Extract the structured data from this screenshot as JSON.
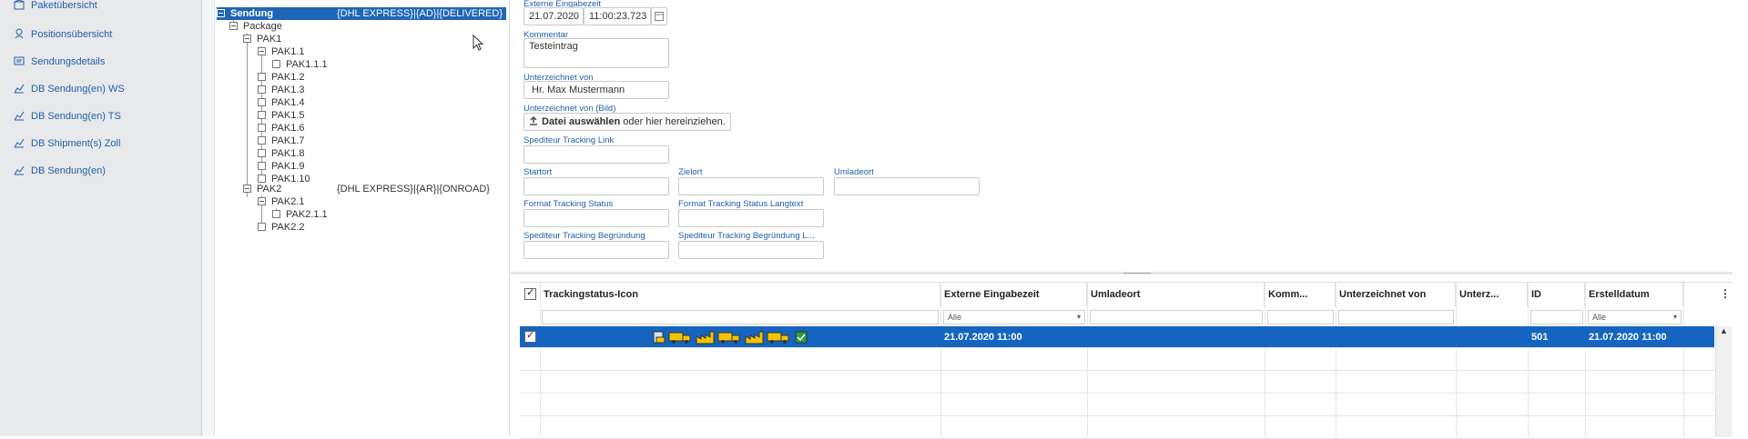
{
  "sidebar": {
    "items": [
      {
        "label": "Paketübersicht",
        "icon": "package-icon"
      },
      {
        "label": "Positionsübersicht",
        "icon": "position-icon"
      },
      {
        "label": "Sendungsdetails",
        "icon": "details-icon"
      },
      {
        "label": "DB Sendung(en) WS",
        "icon": "chart-icon"
      },
      {
        "label": "DB Sendung(en) TS",
        "icon": "chart-icon"
      },
      {
        "label": "DB Shipment(s) Zoll",
        "icon": "chart-icon"
      },
      {
        "label": "DB Sendung(en)",
        "icon": "chart-icon"
      }
    ]
  },
  "tree": {
    "root": {
      "label": "Sendung",
      "info": "{DHL EXPRESS}|{AD}|{DELIVERED}"
    },
    "package": "Package",
    "pak1": "PAK1",
    "pak1_1": "PAK1.1",
    "pak1_1_1": "PAK1.1.1",
    "pak1_children": [
      "PAK1.2",
      "PAK1.3",
      "PAK1.4",
      "PAK1.5",
      "PAK1.6",
      "PAK1.7",
      "PAK1.8",
      "PAK1.9",
      "PAK1.10"
    ],
    "pak2": {
      "label": "PAK2",
      "info": "{DHL EXPRESS}|{AR}|{ONROAD}"
    },
    "pak2_1": "PAK2.1",
    "pak2_1_1": "PAK2.1.1",
    "pak2_2": "PAK2.2"
  },
  "form": {
    "externe_eingabezeit": {
      "label": "Externe Eingabezeit",
      "date": "21.07.2020",
      "time": "11:00:23.723"
    },
    "kommentar": {
      "label": "Kommentar",
      "value": "Testeintrag"
    },
    "unterzeichnet_von": {
      "label": "Unterzeichnet von",
      "value": "Hr. Max Mustermann"
    },
    "unterzeichnet_bild": {
      "label": "Unterzeichnet von (Bild)",
      "button_bold": "Datei auswählen",
      "button_rest": " oder hier hereinziehen."
    },
    "spediteur_link": {
      "label": "Spediteur Tracking Link",
      "value": ""
    },
    "startort": {
      "label": "Startort",
      "value": ""
    },
    "zielort": {
      "label": "Zielort",
      "value": ""
    },
    "umladeort": {
      "label": "Umladeort",
      "value": ""
    },
    "format_status": {
      "label": "Format Tracking Status",
      "value": ""
    },
    "format_status_lang": {
      "label": "Format Tracking Status Langtext",
      "value": ""
    },
    "begruendung": {
      "label": "Spediteur Tracking Begründung",
      "value": ""
    },
    "begruendung_lang": {
      "label": "Spediteur Tracking Begründung L...",
      "value": ""
    }
  },
  "grid": {
    "columns": [
      "Trackingstatus-Icon",
      "Externe Eingabezeit",
      "Umladeort",
      "Komm...",
      "Unterzeichnet von",
      "Unterz...",
      "ID",
      "Erstelldatum"
    ],
    "filters": {
      "externe_eingabezeit": "Alle",
      "erstelldatum": "Alle"
    },
    "rows": [
      {
        "externe_eingabezeit": "21.07.2020 11:00",
        "umladeort": "",
        "kommentar": "",
        "unterzeichnet_von": "",
        "unterz": "",
        "id": "501",
        "erstelldatum": "21.07.2020 11:00",
        "selected": true
      }
    ],
    "status_icon_names": [
      "document-scan-icon",
      "truck-icon",
      "factory-icon",
      "truck-icon",
      "factory-icon",
      "truck-icon",
      "delivered-icon"
    ]
  },
  "colors": {
    "accent": "#1565c0",
    "link": "#1f5fa8",
    "icon_yellow": "#f5c400"
  }
}
